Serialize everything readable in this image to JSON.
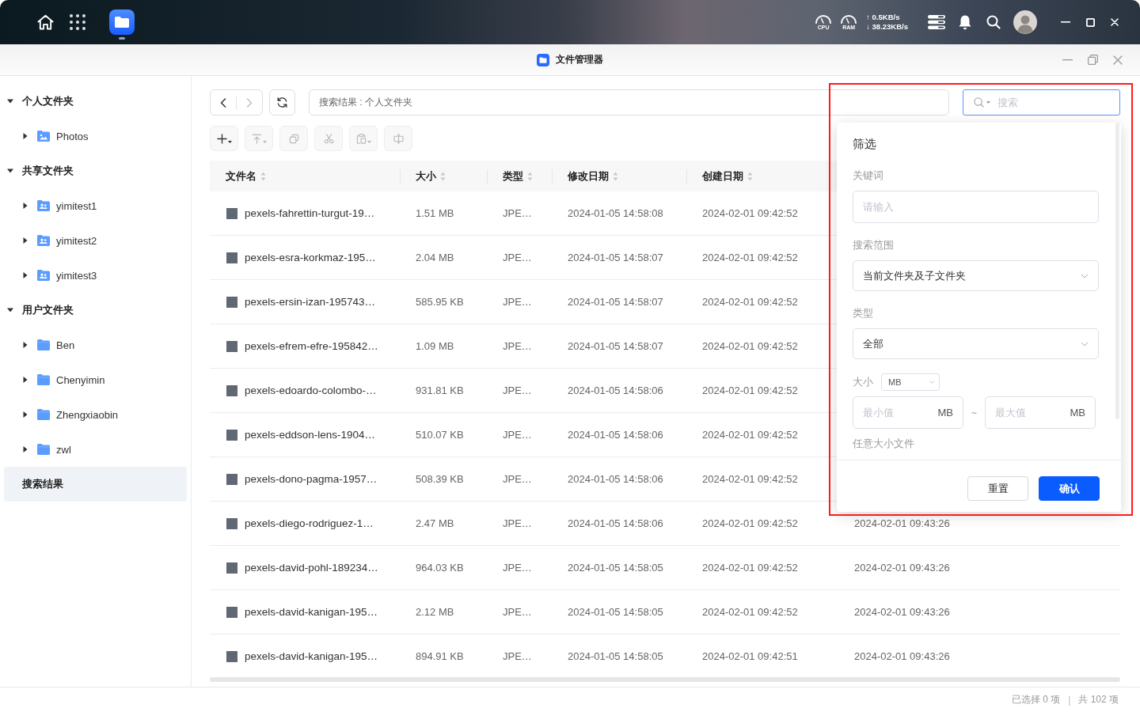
{
  "desktop": {
    "taskbar": [
      {
        "kind": "file-manager",
        "open": true
      }
    ],
    "gauges": [
      {
        "label": "CPU"
      },
      {
        "label": "RAM"
      }
    ],
    "network": {
      "upload": "↑ 0.5KB/s",
      "download": "↓ 38.23KB/s"
    }
  },
  "window": {
    "title": "文件管理器"
  },
  "sidebar": {
    "items": [
      {
        "label": "个人文件夹",
        "kind": "group",
        "expanded": true,
        "selected": false,
        "children": [
          {
            "label": "Photos",
            "kind": "photos",
            "expanded": false,
            "selected": false
          }
        ]
      },
      {
        "label": "共享文件夹",
        "kind": "group",
        "expanded": true,
        "selected": false,
        "children": [
          {
            "label": "yimitest1",
            "kind": "shared",
            "expanded": false,
            "selected": false
          },
          {
            "label": "yimitest2",
            "kind": "shared",
            "expanded": false,
            "selected": false
          },
          {
            "label": "yimitest3",
            "kind": "shared",
            "expanded": false,
            "selected": false
          }
        ]
      },
      {
        "label": "用户文件夹",
        "kind": "group",
        "expanded": true,
        "selected": false,
        "children": [
          {
            "label": "Ben",
            "kind": "user",
            "expanded": false,
            "selected": false
          },
          {
            "label": "Chenyimin",
            "kind": "user",
            "expanded": false,
            "selected": false
          },
          {
            "label": "Zhengxiaobin",
            "kind": "user",
            "expanded": false,
            "selected": false
          },
          {
            "label": "zwl",
            "kind": "user",
            "expanded": false,
            "selected": false
          }
        ]
      },
      {
        "label": "搜索结果",
        "kind": "result",
        "selected": true
      }
    ]
  },
  "toolbar": {
    "back": {
      "disabled": false
    },
    "forward": {
      "disabled": true
    },
    "path": "搜索结果 : 个人文件夹",
    "search": {
      "placeholder": "搜索"
    },
    "actions": [
      {
        "kind": "new",
        "dropdown": true,
        "disabled": false
      },
      {
        "kind": "upload",
        "dropdown": true,
        "disabled": true
      },
      {
        "kind": "copy",
        "dropdown": false,
        "disabled": true
      },
      {
        "kind": "cut",
        "dropdown": false,
        "disabled": true
      },
      {
        "kind": "paste",
        "dropdown": true,
        "disabled": true
      },
      {
        "kind": "rename",
        "dropdown": false,
        "disabled": true
      }
    ]
  },
  "table": {
    "columns": [
      {
        "label": "文件名"
      },
      {
        "label": "大小"
      },
      {
        "label": "类型"
      },
      {
        "label": "修改日期"
      },
      {
        "label": "创建日期"
      }
    ],
    "rows": [
      {
        "name": "pexels-fahrettin-turgut-19…",
        "size": "1.51 MB",
        "type": "JPE…",
        "modified": "2024-01-05 14:58:08",
        "created": "2024-02-01 09:42:52"
      },
      {
        "name": "pexels-esra-korkmaz-195…",
        "size": "2.04 MB",
        "type": "JPE…",
        "modified": "2024-01-05 14:58:07",
        "created": "2024-02-01 09:42:52"
      },
      {
        "name": "pexels-ersin-izan-195743…",
        "size": "585.95 KB",
        "type": "JPE…",
        "modified": "2024-01-05 14:58:07",
        "created": "2024-02-01 09:42:52"
      },
      {
        "name": "pexels-efrem-efre-195842…",
        "size": "1.09 MB",
        "type": "JPE…",
        "modified": "2024-01-05 14:58:07",
        "created": "2024-02-01 09:42:52"
      },
      {
        "name": "pexels-edoardo-colombo-…",
        "size": "931.81 KB",
        "type": "JPE…",
        "modified": "2024-01-05 14:58:06",
        "created": "2024-02-01 09:42:52"
      },
      {
        "name": "pexels-eddson-lens-1904…",
        "size": "510.07 KB",
        "type": "JPE…",
        "modified": "2024-01-05 14:58:06",
        "created": "2024-02-01 09:42:52"
      },
      {
        "name": "pexels-dono-pagma-1957…",
        "size": "508.39 KB",
        "type": "JPE…",
        "modified": "2024-01-05 14:58:06",
        "created": "2024-02-01 09:42:52"
      },
      {
        "name": "pexels-diego-rodriguez-1…",
        "size": "2.47 MB",
        "type": "JPE…",
        "modified": "2024-01-05 14:58:06",
        "created": "2024-02-01 09:42:52",
        "column_6": "2024-02-01 09:43:26"
      },
      {
        "name": "pexels-david-pohl-189234…",
        "size": "964.03 KB",
        "type": "JPE…",
        "modified": "2024-01-05 14:58:05",
        "created": "2024-02-01 09:42:52",
        "column_6": "2024-02-01 09:43:26"
      },
      {
        "name": "pexels-david-kanigan-195…",
        "size": "2.12 MB",
        "type": "JPE…",
        "modified": "2024-01-05 14:58:05",
        "created": "2024-02-01 09:42:52",
        "column_6": "2024-02-01 09:43:26"
      },
      {
        "name": "pexels-david-kanigan-195…",
        "size": "894.91 KB",
        "type": "JPE…",
        "modified": "2024-01-05 14:58:05",
        "created": "2024-02-01 09:42:51",
        "column_6": "2024-02-01 09:43:26"
      }
    ]
  },
  "filter_panel": {
    "title": "筛选",
    "keyword": {
      "label": "关键词",
      "placeholder": "请输入"
    },
    "scope": {
      "label": "搜索范围",
      "value": "当前文件夹及子文件夹"
    },
    "type": {
      "label": "类型",
      "value": "全部"
    },
    "size": {
      "label": "大小",
      "unit": "MB",
      "min": {
        "placeholder": "最小值",
        "suffix": "MB"
      },
      "separator": "~",
      "max": {
        "placeholder": "最大值",
        "suffix": "MB"
      },
      "hint": "任意大小文件"
    },
    "buttons": [
      {
        "label": "重置",
        "kind": "secondary"
      },
      {
        "label": "确认",
        "kind": "primary"
      }
    ]
  },
  "status_bar": {
    "selected": "已选择 0 项",
    "separator": "|",
    "total": "共 102 项"
  }
}
